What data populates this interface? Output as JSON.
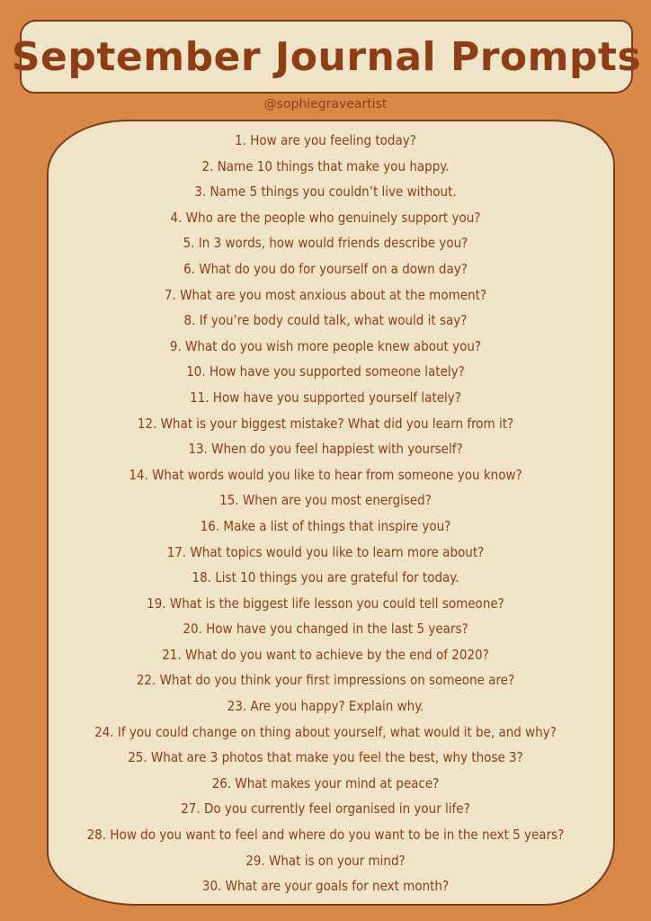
{
  "title": "September Journal Prompts",
  "handle": "@sophiegraveartist",
  "prompts": [
    "1. How are you feeling today?",
    "2. Name 10 things that make you happy.",
    "3. Name 5 things you couldn’t live without.",
    "4. Who are the people who genuinely support you?",
    "5. In 3 words, how would friends describe you?",
    "6. What do you do for yourself on a down day?",
    "7. What are you most anxious about at the moment?",
    "8. If you’re body could talk, what would it say?",
    "9. What do you wish more people knew about you?",
    "10. How have you supported someone lately?",
    "11. How have you supported yourself lately?",
    "12. What is your biggest mistake? What did you learn from it?",
    "13. When do you feel happiest with yourself?",
    "14. What words would you like to hear from someone you know?",
    "15. When are you most energised?",
    "16. Make a list of things that inspire you?",
    "17. What topics would you like to learn more about?",
    "18. List 10 things you are grateful for today.",
    "19. What is the biggest life lesson you could tell someone?",
    "20. How have you changed in the last 5 years?",
    "21. What do you want to achieve by the end of 2020?",
    "22. What do you think your first impressions on someone are?",
    "23. Are you happy? Explain why.",
    "24. If you could change on thing about yourself, what would it be, and why?",
    "25. What are 3 photos that make you feel the best, why those 3?",
    "26. What makes your mind at peace?",
    "27. Do you currently feel organised in your life?",
    "28. How do you want to feel and where do you want to be in the next 5 years?",
    "29. What is on your mind?",
    "30.  What are your goals for next month?"
  ],
  "colors": {
    "background": "#d88947",
    "panel": "#efe4c8",
    "text": "#8e3d14",
    "outline": "#7a3d1a"
  }
}
